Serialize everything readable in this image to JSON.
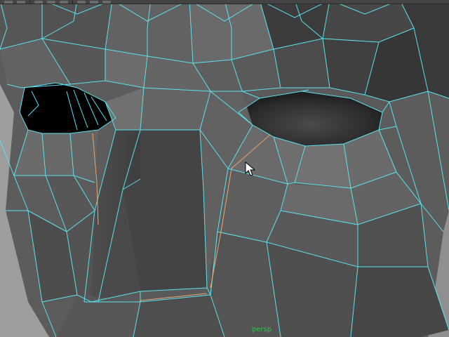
{
  "viewport": {
    "camera_name": "persp",
    "mesh_fill_color": "#5a5a5a",
    "wire_color": "#5de1ef",
    "selected_edge_color": "#e7a66f",
    "eye_socket_color": "#000000",
    "background_color": "#9d9d9d"
  },
  "toolbar": {
    "icons": [
      "tool-icon",
      "tool-icon",
      "tool-icon",
      "tool-icon",
      "tool-icon",
      "tool-icon",
      "tool-icon",
      "tool-icon",
      "tool-icon"
    ]
  }
}
